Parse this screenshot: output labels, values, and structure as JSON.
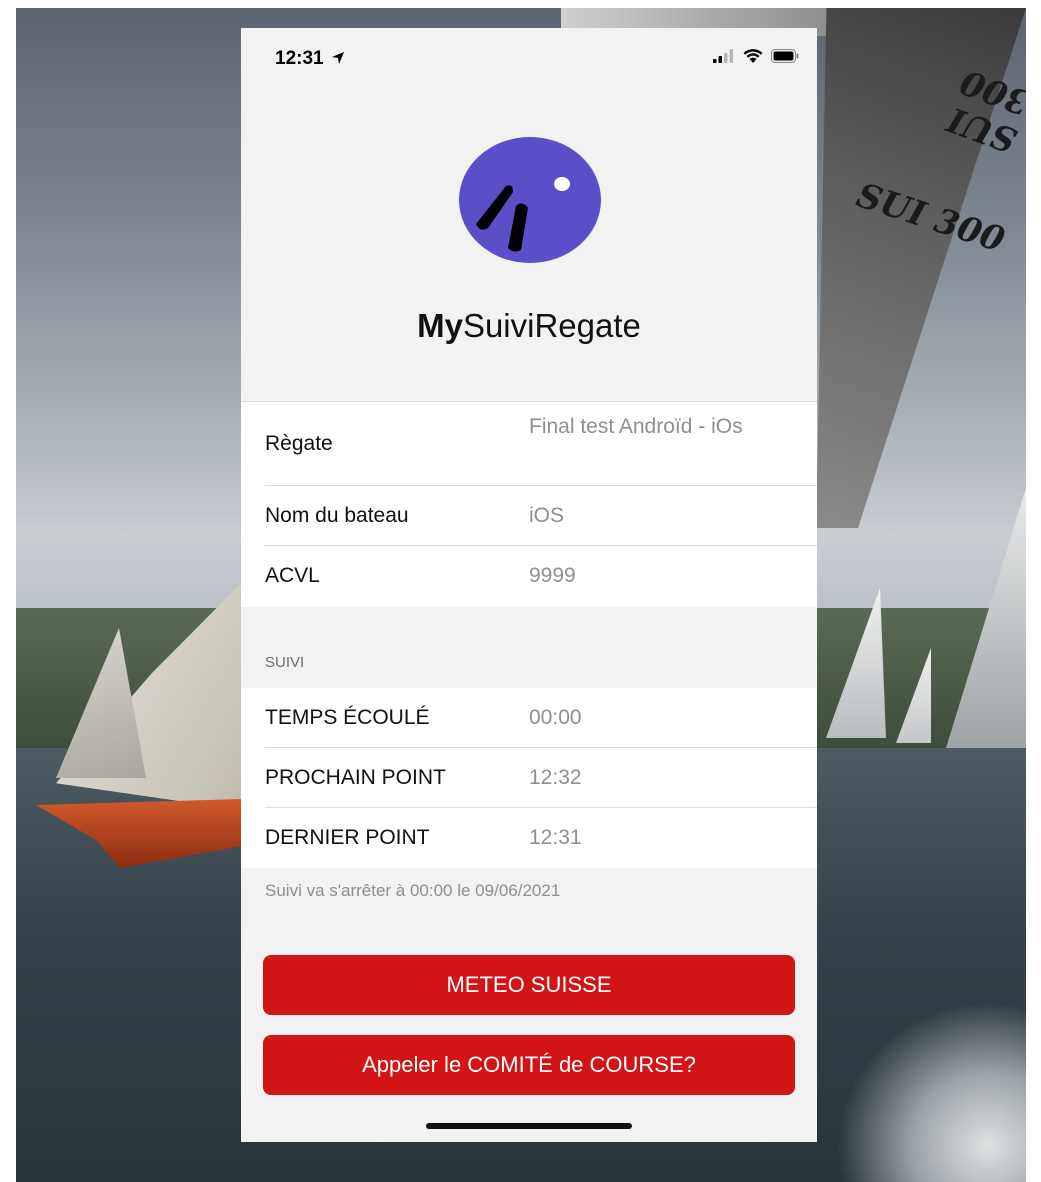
{
  "status_bar": {
    "time": "12:31",
    "location_icon": "location-arrow-icon",
    "signal_icon": "cellular-signal-icon",
    "wifi_icon": "wifi-icon",
    "battery_icon": "battery-icon"
  },
  "background": {
    "sail_numbers": [
      "SUI 300",
      "SUI 300"
    ]
  },
  "app": {
    "logo_icon": "sailboat-logo-icon",
    "logo_color": "#5b4fc8",
    "name_bold": "My",
    "name_rest": "SuiviRegate"
  },
  "info": {
    "rows": [
      {
        "label": "Règate",
        "value": "Final test Androïd - iOs"
      },
      {
        "label": "Nom du bateau",
        "value": "iOS"
      },
      {
        "label": "ACVL",
        "value": "9999"
      }
    ]
  },
  "tracking": {
    "section_label": "SUIVI",
    "rows": [
      {
        "label": "TEMPS ÉCOULÉ",
        "value": "00:00"
      },
      {
        "label": "PROCHAIN POINT",
        "value": "12:32"
      },
      {
        "label": "DERNIER POINT",
        "value": "12:31"
      }
    ],
    "footnote": "Suivi va s'arrêter à 00:00 le 09/06/2021"
  },
  "buttons": {
    "meteo": "METEO SUISSE",
    "call": "Appeler le COMITÉ de COURSE?"
  },
  "colors": {
    "button_red": "#d21414",
    "background": "#f2f2f2"
  }
}
